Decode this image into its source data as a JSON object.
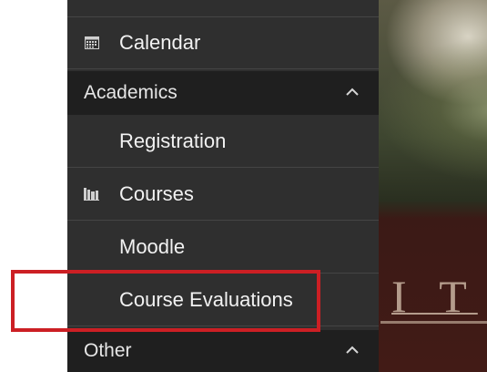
{
  "menu": {
    "calendar_label": "Calendar",
    "academics_section": "Academics",
    "registration_label": "Registration",
    "courses_label": "Courses",
    "moodle_label": "Moodle",
    "course_evaluations_label": "Course Evaluations",
    "other_section": "Other"
  },
  "background": {
    "letters": "I T"
  },
  "colors": {
    "drawer": "#2f2f2f",
    "section_header": "#1f1f1f",
    "highlight": "#cc1f24"
  },
  "icons": {
    "calendar": "calendar-icon",
    "courses": "books-icon",
    "collapse": "chevron-up-icon"
  }
}
